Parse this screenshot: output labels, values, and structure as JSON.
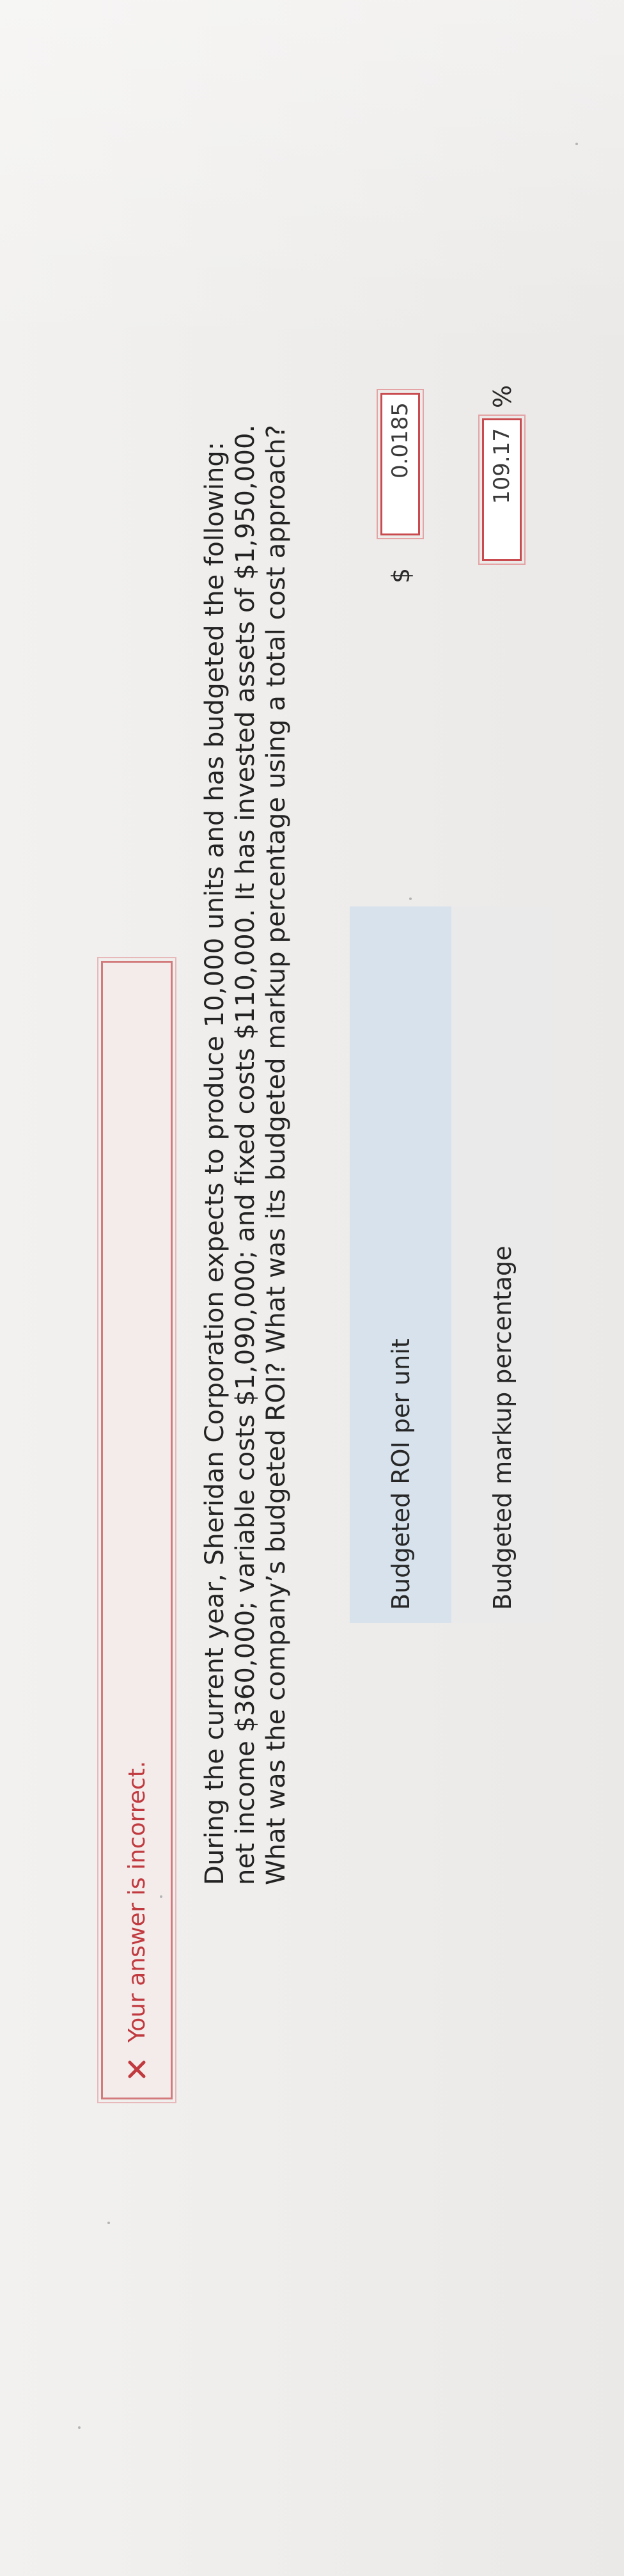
{
  "alert": {
    "text": "Your answer is incorrect.",
    "icon": "close-icon",
    "color": "#c03a3f"
  },
  "question": {
    "text": "During the current year, Sheridan Corporation expects to produce 10,000 units and has budgeted the following: net income $360,000; variable costs $1,090,000; and fixed costs $110,000. It has invested assets of $1,950,000. What was the company’s budgeted ROI? What was its budgeted markup percentage using a total cost approach?"
  },
  "answers": {
    "roi": {
      "label": "Budgeted ROI per unit",
      "currency": "$",
      "value": "0.0185"
    },
    "markup": {
      "label": "Budgeted markup percentage",
      "value": "109.17",
      "unit": "%"
    }
  }
}
